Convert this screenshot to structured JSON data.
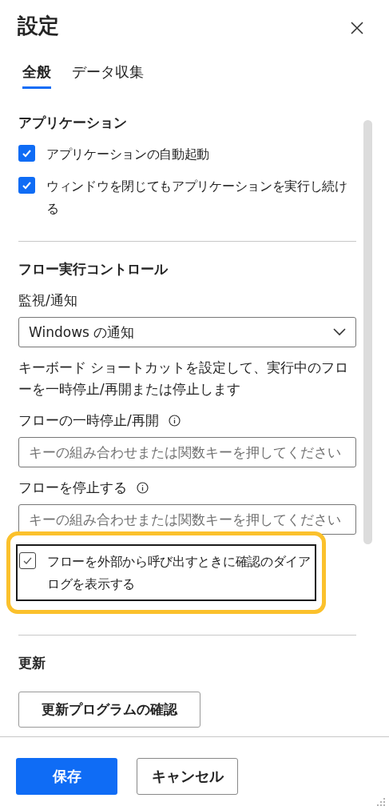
{
  "title": "設定",
  "tabs": [
    {
      "label": "全般",
      "selected": true
    },
    {
      "label": "データ収集",
      "selected": false
    }
  ],
  "sections": [
    {
      "heading": "アプリケーション",
      "items": [
        {
          "kind": "checkbox",
          "label": "アプリケーションの自動起動",
          "checked": true,
          "focused": false
        },
        {
          "kind": "checkbox",
          "label": "ウィンドウを閉じてもアプリケーションを実行し続ける",
          "checked": true,
          "focused": false
        }
      ]
    },
    {
      "heading": "フロー実行コントロール",
      "items": [
        {
          "kind": "dropdown",
          "label": "監視/通知",
          "value": "Windows の通知"
        },
        {
          "kind": "text",
          "text": "キーボード ショートカットを設定して、実行中のフローを一時停止/再開または停止します"
        },
        {
          "kind": "key_input",
          "label": "フローの一時停止/再開",
          "placeholder": "キーの組み合わせまたは関数キーを押してください"
        },
        {
          "kind": "key_input",
          "label": "フローを停止する",
          "placeholder": "キーの組み合わせまたは関数キーを押してください"
        },
        {
          "kind": "checkbox",
          "label": "フローを外部から呼び出すときに確認のダイアログを表示する",
          "checked": true,
          "focused": true
        }
      ]
    },
    {
      "heading": "更新",
      "items": [
        {
          "kind": "button",
          "label": "更新プログラムの確認"
        }
      ]
    }
  ],
  "footer": {
    "buttons": [
      {
        "label": "保存",
        "kind": "primary"
      },
      {
        "label": "キャンセル",
        "kind": "secondary"
      }
    ]
  }
}
